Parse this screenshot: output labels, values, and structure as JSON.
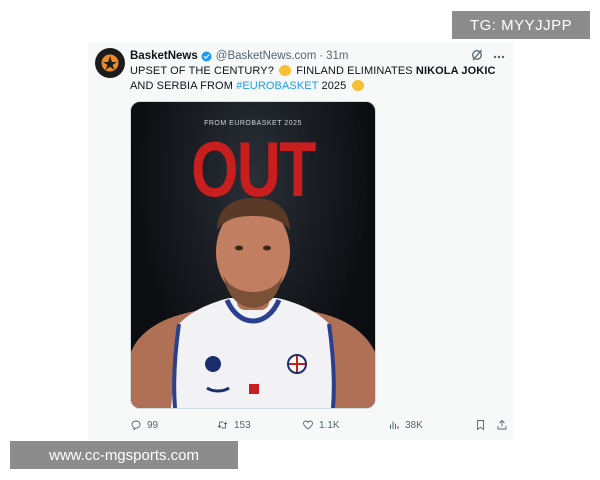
{
  "tweet": {
    "display_name": "BasketNews",
    "handle": "@BasketNews.com",
    "separator": "·",
    "time": "31m",
    "text": {
      "part1": "UPSET OF THE CENTURY?",
      "part2": "FINLAND ELIMINATES",
      "bold": "NIKOLA JOKIC",
      "part3": "AND SERBIA FROM",
      "hashtag": "#EUROBASKET",
      "part4": "2025"
    },
    "media": {
      "caption": "FROM EUROBASKET 2025",
      "headline": "OUT"
    },
    "actions": {
      "replies": "99",
      "reposts": "153",
      "likes": "1.1K",
      "views": "38K"
    }
  },
  "watermarks": {
    "top_right": "TG: MYYJJPP",
    "bottom_left": "www.cc-mgsports.com"
  },
  "colors": {
    "accent": "#1d9bf0",
    "headline_red": "#c81e1e",
    "muted": "#536471"
  }
}
